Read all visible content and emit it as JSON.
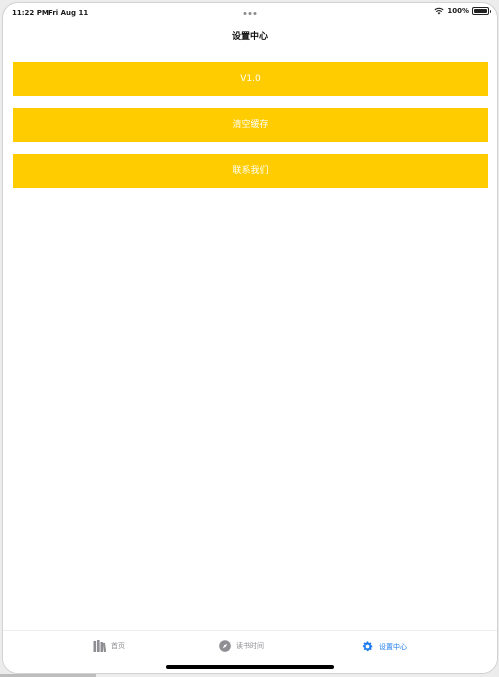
{
  "status_bar": {
    "time": "11:22 PM",
    "date": "Fri Aug 11",
    "battery": "100%",
    "icons": [
      "wifi-icon",
      "battery-icon"
    ]
  },
  "nav": {
    "title": "设置中心"
  },
  "menu": {
    "items": [
      {
        "label": "V1.0"
      },
      {
        "label": "清空缓存"
      },
      {
        "label": "联系我们"
      }
    ]
  },
  "tab_bar": {
    "tabs": [
      {
        "label": "首页",
        "icon": "library-icon"
      },
      {
        "label": "读书时间",
        "icon": "compass-icon"
      },
      {
        "label": "设置中心",
        "icon": "gear-icon",
        "selected": true
      }
    ]
  },
  "colors": {
    "accent": "#ffcc00",
    "tab_active": "#1e7cf0",
    "tab_inactive": "#8e8e93"
  }
}
